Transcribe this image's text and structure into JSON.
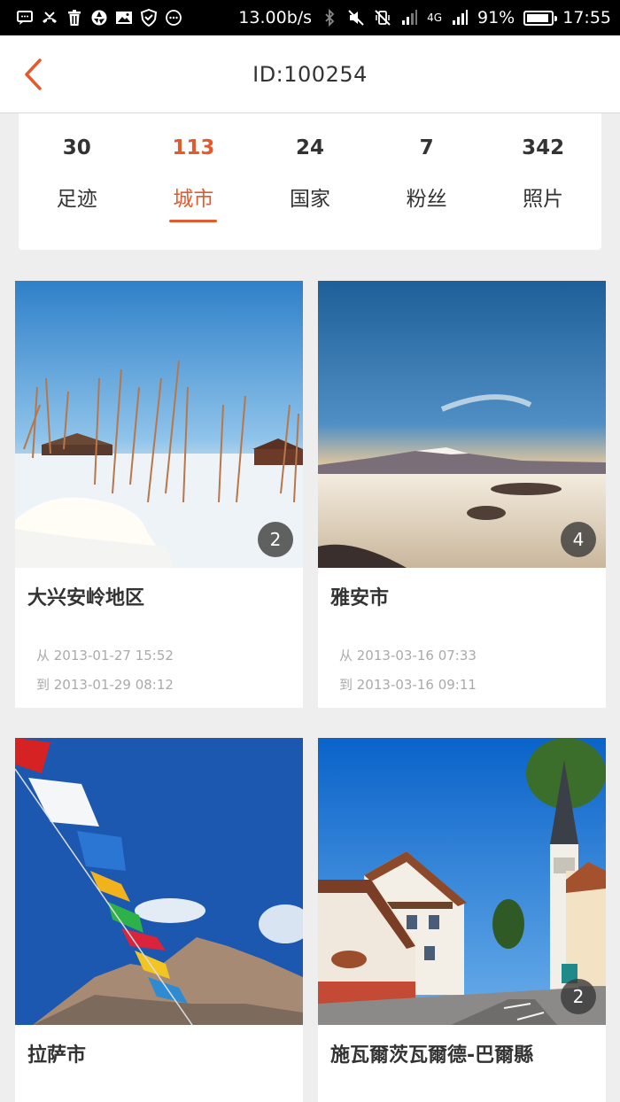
{
  "status_bar": {
    "net_speed": "13.00b/s",
    "network": "4G",
    "battery": "91%",
    "battery_level": 0.91,
    "time": "17:55"
  },
  "header": {
    "title": "ID:100254"
  },
  "stats": [
    {
      "value": "30",
      "label": "足迹"
    },
    {
      "value": "113",
      "label": "城市"
    },
    {
      "value": "24",
      "label": "国家"
    },
    {
      "value": "7",
      "label": "粉丝"
    },
    {
      "value": "342",
      "label": "照片"
    }
  ],
  "active_tab": "城市",
  "colors": {
    "accent": "#e35b2c"
  },
  "cards": [
    {
      "title": "大兴安岭地区",
      "photo_count": "2",
      "from": "从 2013-01-27 15:52",
      "to": "到 2013-01-29 08:12"
    },
    {
      "title": "雅安市",
      "photo_count": "4",
      "from": "从 2013-03-16 07:33",
      "to": "到 2013-03-16 09:11"
    },
    {
      "title": "拉萨市",
      "photo_count": ""
    },
    {
      "title": "施瓦爾茨瓦爾德-巴爾縣",
      "photo_count": "2"
    }
  ]
}
